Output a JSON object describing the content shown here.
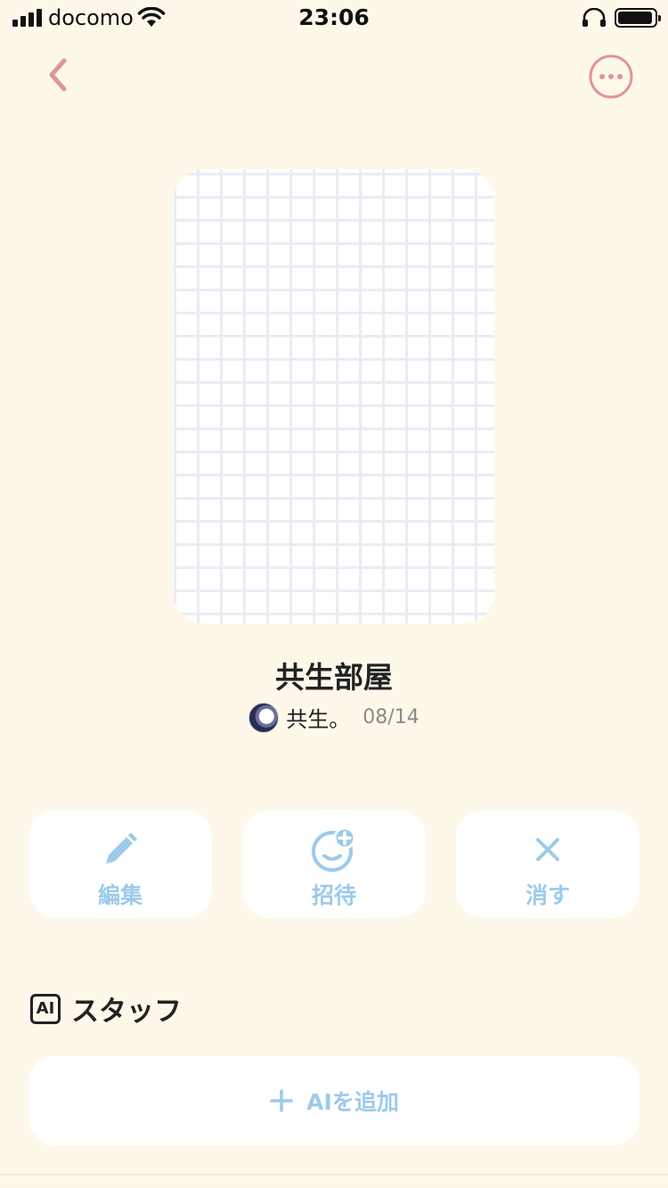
{
  "status_bar": {
    "carrier": "docomo",
    "time": "23:06",
    "icons": [
      "signal-icon",
      "wifi-icon",
      "headphones-icon",
      "battery-icon"
    ]
  },
  "nav": {
    "back_icon": "chevron-left-icon",
    "more_icon": "more-options-icon"
  },
  "room": {
    "title": "共生部屋",
    "owner_name": "共生。",
    "date": "08/14"
  },
  "actions": [
    {
      "label": "編集",
      "icon": "pencil-icon"
    },
    {
      "label": "招待",
      "icon": "add-person-icon"
    },
    {
      "label": "消す",
      "icon": "close-icon"
    }
  ],
  "staff": {
    "badge": "AI",
    "title": "スタッフ",
    "add_label": "AIを追加",
    "add_icon": "plus-icon"
  },
  "colors": {
    "background": "#fdf8ea",
    "accent_pink": "#e0939b",
    "accent_blue": "#9ccaea",
    "card": "#ffffff"
  }
}
